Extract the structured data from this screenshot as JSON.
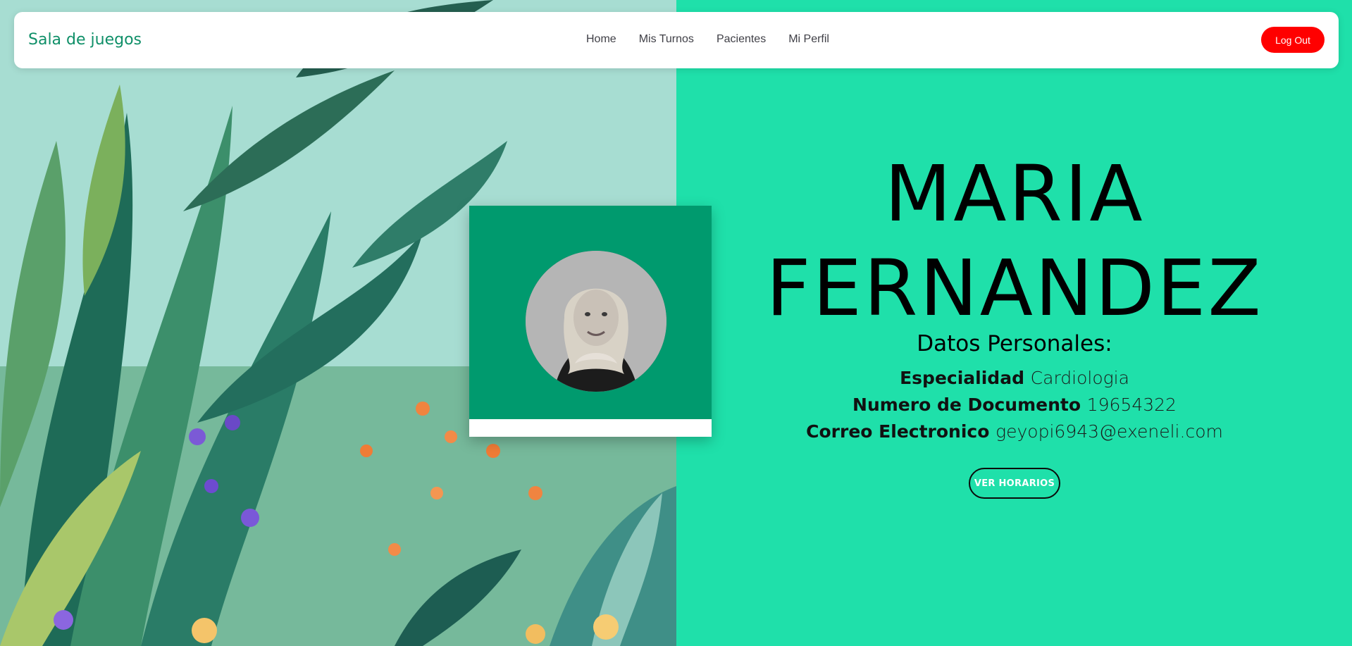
{
  "navbar": {
    "brand": "Sala de juegos",
    "links": [
      "Home",
      "Mis Turnos",
      "Pacientes",
      "Mi Perfil"
    ],
    "logout_label": "Log Out"
  },
  "profile": {
    "first_name": "MARIA",
    "last_name": "FERNANDEZ",
    "section_title": "Datos Personales:",
    "fields": [
      {
        "label": "Especialidad",
        "value": "Cardiologia"
      },
      {
        "label": "Numero de Documento",
        "value": "19654322"
      },
      {
        "label": "Correo Electronico",
        "value": "geyopi6943@exeneli.com"
      }
    ],
    "button_label": "VER HORARIOS"
  },
  "colors": {
    "accent": "#1fe0aa",
    "card_green": "#009a6e",
    "brand_text": "#0f8f68",
    "logout": "#ff0000"
  }
}
